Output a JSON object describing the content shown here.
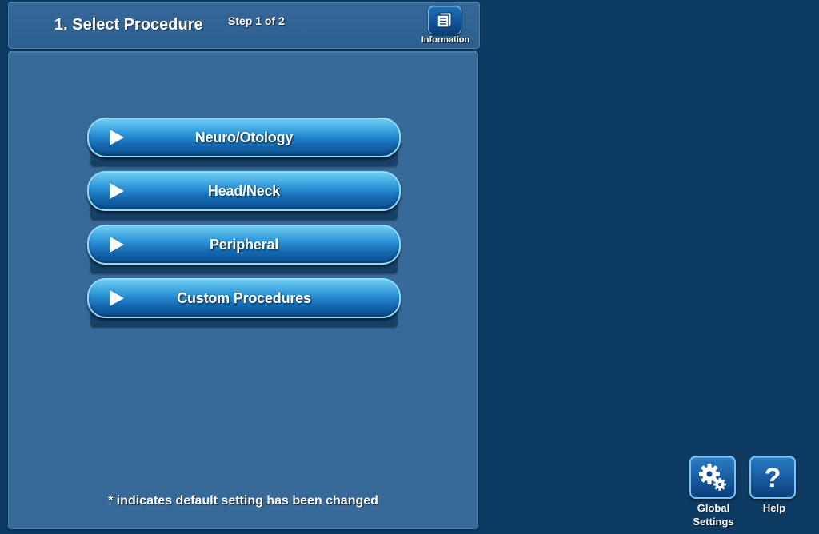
{
  "header": {
    "title": "1. Select Procedure",
    "step": "Step 1 of 2",
    "information_label": "Information",
    "information_icon": "document-icon"
  },
  "procedures": [
    {
      "label": "Neuro/Otology",
      "icon": "play-icon"
    },
    {
      "label": "Head/Neck",
      "icon": "play-icon"
    },
    {
      "label": "Peripheral",
      "icon": "play-icon"
    },
    {
      "label": "Custom Procedures",
      "icon": "play-icon"
    }
  ],
  "footnote": "* indicates default setting has been changed",
  "bottom_buttons": {
    "global_settings_line1": "Global",
    "global_settings_line2": "Settings",
    "global_settings_icon": "gears-icon",
    "help_label": "Help",
    "help_icon": "question-mark-icon"
  },
  "colors": {
    "background": "#0d3b63",
    "panel": "#386a99",
    "button_light": "#6fcdf4",
    "button_dark": "#0e4f8f"
  }
}
